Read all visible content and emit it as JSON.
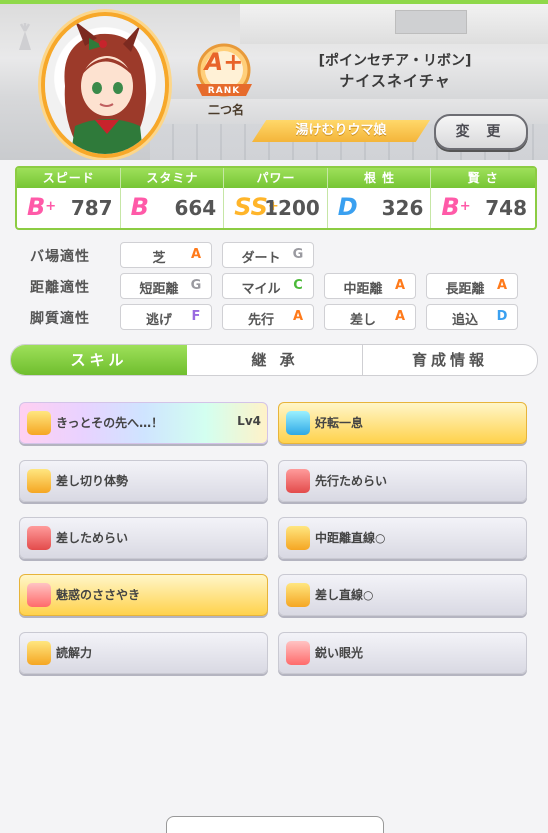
{
  "header": {
    "rank": "A+",
    "rank_caption": "RANK",
    "rank_name": "二つ名",
    "title": "[ポインセチア・リボン]",
    "name": "ナイスネイチャ",
    "alias": "湯けむりウマ娘",
    "change_button": "変 更"
  },
  "stats": [
    {
      "label": "スピード",
      "grade": "B",
      "plus": "+",
      "value": "787",
      "icon": "shoe-icon"
    },
    {
      "label": "スタミナ",
      "grade": "B",
      "plus": "",
      "value": "664",
      "icon": "heart-icon"
    },
    {
      "label": "パワー",
      "grade": "SS",
      "plus": "+",
      "value": "1200",
      "icon": "muscle-icon"
    },
    {
      "label": "根 性",
      "grade": "D",
      "plus": "",
      "value": "326",
      "icon": "flame-icon"
    },
    {
      "label": "賢 さ",
      "grade": "B",
      "plus": "+",
      "value": "748",
      "icon": "cap-icon"
    }
  ],
  "aptitude": {
    "track": {
      "label": "バ場適性",
      "items": [
        {
          "name": "芝",
          "grade": "A"
        },
        {
          "name": "ダート",
          "grade": "G"
        }
      ]
    },
    "distance": {
      "label": "距離適性",
      "items": [
        {
          "name": "短距離",
          "grade": "G"
        },
        {
          "name": "マイル",
          "grade": "C"
        },
        {
          "name": "中距離",
          "grade": "A"
        },
        {
          "name": "長距離",
          "grade": "A"
        }
      ]
    },
    "style": {
      "label": "脚質適性",
      "items": [
        {
          "name": "逃げ",
          "grade": "F"
        },
        {
          "name": "先行",
          "grade": "A"
        },
        {
          "name": "差し",
          "grade": "A"
        },
        {
          "name": "追込",
          "grade": "D"
        }
      ]
    }
  },
  "tabs": [
    "スキル",
    "継 承",
    "育成情報"
  ],
  "skills": [
    {
      "name": "きっとその先へ…！",
      "level": "Lv4",
      "style": "rainbow",
      "icon": "yellow"
    },
    {
      "name": "好転一息",
      "level": "",
      "style": "gold",
      "icon": "blue"
    },
    {
      "name": "差し切り体勢",
      "level": "",
      "style": "normal",
      "icon": "yellow"
    },
    {
      "name": "先行ためらい",
      "level": "",
      "style": "normal",
      "icon": "red"
    },
    {
      "name": "差しためらい",
      "level": "",
      "style": "normal",
      "icon": "red"
    },
    {
      "name": "中距離直線○",
      "level": "",
      "style": "normal",
      "icon": "yellow"
    },
    {
      "name": "魅惑のささやき",
      "level": "",
      "style": "gold",
      "icon": "pink"
    },
    {
      "name": "差し直線○",
      "level": "",
      "style": "normal",
      "icon": "yellow"
    },
    {
      "name": "読解力",
      "level": "",
      "style": "normal",
      "icon": "yellow"
    },
    {
      "name": "鋭い眼光",
      "level": "",
      "style": "normal",
      "icon": "pink"
    }
  ],
  "colors": {
    "green": "#8fd84a",
    "gold": "#ffd24c",
    "pink": "#ff5aa8",
    "orange": "#ffb52a",
    "blue": "#3aa0f0"
  }
}
